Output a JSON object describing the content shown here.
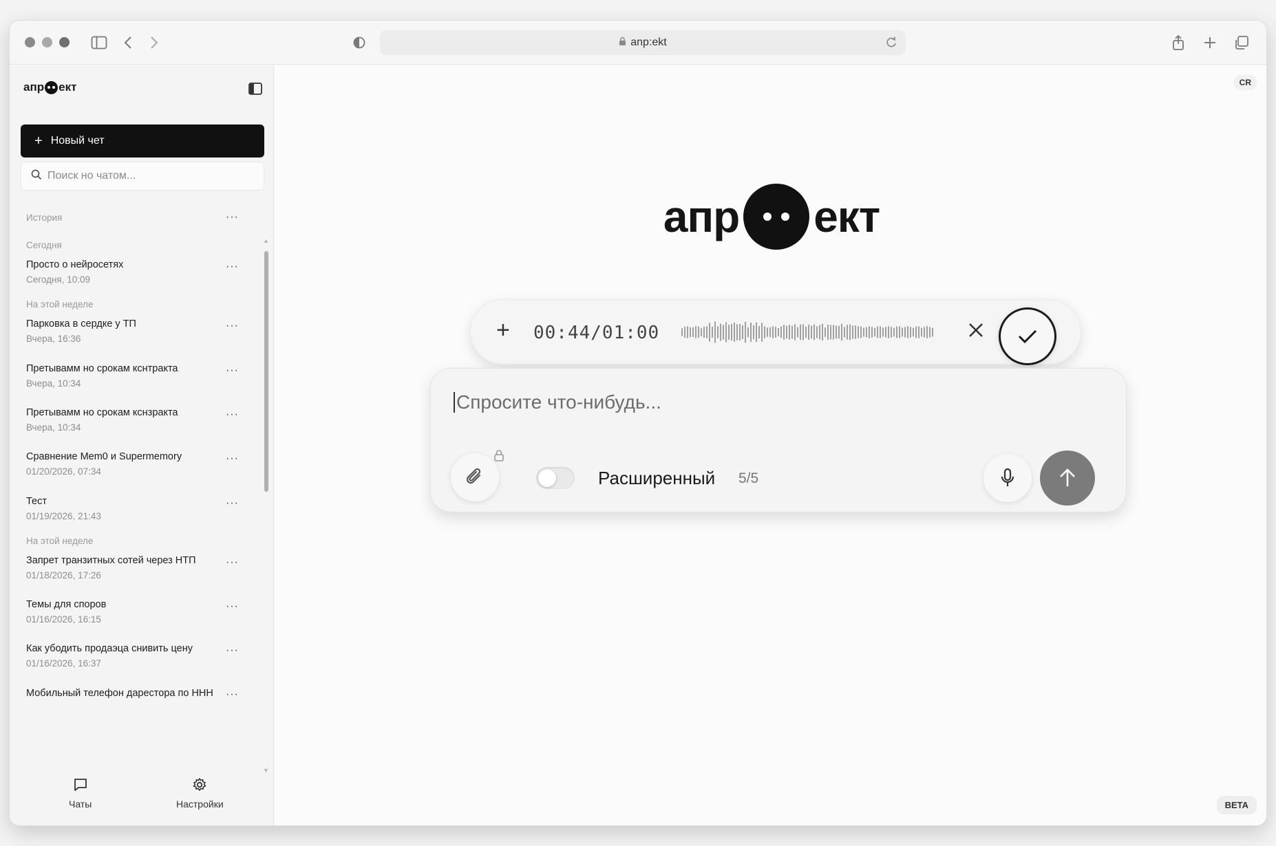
{
  "browser": {
    "url": "anp:ekt"
  },
  "sidebar": {
    "brand": {
      "prefix": "апр",
      "suffix": "ект"
    },
    "new_chat_label": "Новый чет",
    "search_placeholder": "Поиск но чатом...",
    "history_label": "История",
    "more_glyph": "···",
    "sections": [
      {
        "label": "Сегодня"
      },
      {
        "label": "На этой неделе"
      },
      {
        "label": "На этой неделе"
      }
    ],
    "chats": [
      {
        "title": "Просто о нейросетях",
        "date": "Сегодня, 10:09"
      },
      {
        "title": "Парковка в сердке у ТП",
        "date": "Вчера, 16:36"
      },
      {
        "title": "Претывамм но срокам кснтракта",
        "date": "Вчера, 10:34"
      },
      {
        "title": "Претывамм но срокам кснзракта",
        "date": "Вчера, 10:34"
      },
      {
        "title": "Сравнение Mem0 и Supermemory",
        "date": "01/20/2026, 07:34"
      },
      {
        "title": "Тест",
        "date": "01/19/2026, 21:43"
      },
      {
        "title": "Запрет транзитных сотей через НТП",
        "date": "01/18/2026, 17:26"
      },
      {
        "title": "Темы для споров",
        "date": "01/16/2026, 16:15"
      },
      {
        "title": "Как убодить продаэца снивить цену",
        "date": "01/16/2026, 16:37"
      },
      {
        "title": "Мобильный телефон дарестора по ННН",
        "date": ""
      }
    ],
    "nav": {
      "chats_label": "Чаты",
      "settings_label": "Настройки"
    }
  },
  "main": {
    "badge_top": "CR",
    "badge_bottom": "BETA",
    "logo": {
      "prefix": "апр",
      "suffix": "ект"
    },
    "recorder": {
      "time": "00:44/01:00"
    },
    "composer": {
      "placeholder": "Спросите что-нибудь...",
      "mode_label": "Расширенный",
      "mode_count": "5/5",
      "toggle_on": false
    }
  },
  "colors": {
    "accent": "#111111",
    "send_button": "#7b7b7b"
  }
}
